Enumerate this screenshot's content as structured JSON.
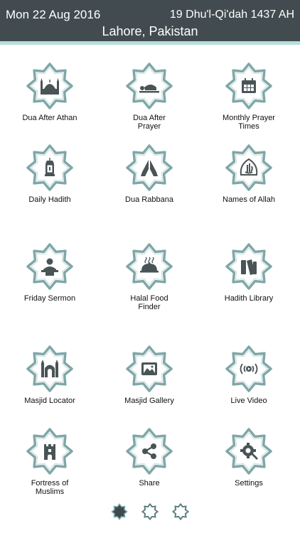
{
  "header": {
    "gregorian_date": "Mon 22 Aug 2016",
    "hijri_date": "19 Dhu'l-Qi'dah 1437 AH",
    "location": "Lahore, Pakistan"
  },
  "colors": {
    "header_bg": "#424c50",
    "accent": "#b6dfdd",
    "star_outline": "#7fa7a8",
    "icon": "#4a5457"
  },
  "menu": [
    {
      "label": "Dua After Athan",
      "icon": "mosque-icon"
    },
    {
      "label": "Dua After Prayer",
      "icon": "prostration-icon"
    },
    {
      "label": "Monthly Prayer Times",
      "icon": "calendar-icon"
    },
    {
      "label": "Daily Hadith",
      "icon": "lantern-icon"
    },
    {
      "label": "Dua Rabbana",
      "icon": "praying-hands-icon"
    },
    {
      "label": "Names of Allah",
      "icon": "allah-calligraphy-icon"
    },
    {
      "label": "Friday Sermon",
      "icon": "sermon-icon"
    },
    {
      "label": "Halal Food Finder",
      "icon": "food-cloche-icon"
    },
    {
      "label": "Hadith Library",
      "icon": "books-icon"
    },
    {
      "label": "Masjid Locator",
      "icon": "masjid-icon"
    },
    {
      "label": "Masjid Gallery",
      "icon": "gallery-icon"
    },
    {
      "label": "Live Video",
      "icon": "video-icon"
    },
    {
      "label": "Fortress of Muslims",
      "icon": "fortress-icon"
    },
    {
      "label": "Share",
      "icon": "share-icon"
    },
    {
      "label": "Settings",
      "icon": "settings-icon"
    }
  ],
  "pagination": {
    "pages": 3,
    "current_page": 1
  }
}
